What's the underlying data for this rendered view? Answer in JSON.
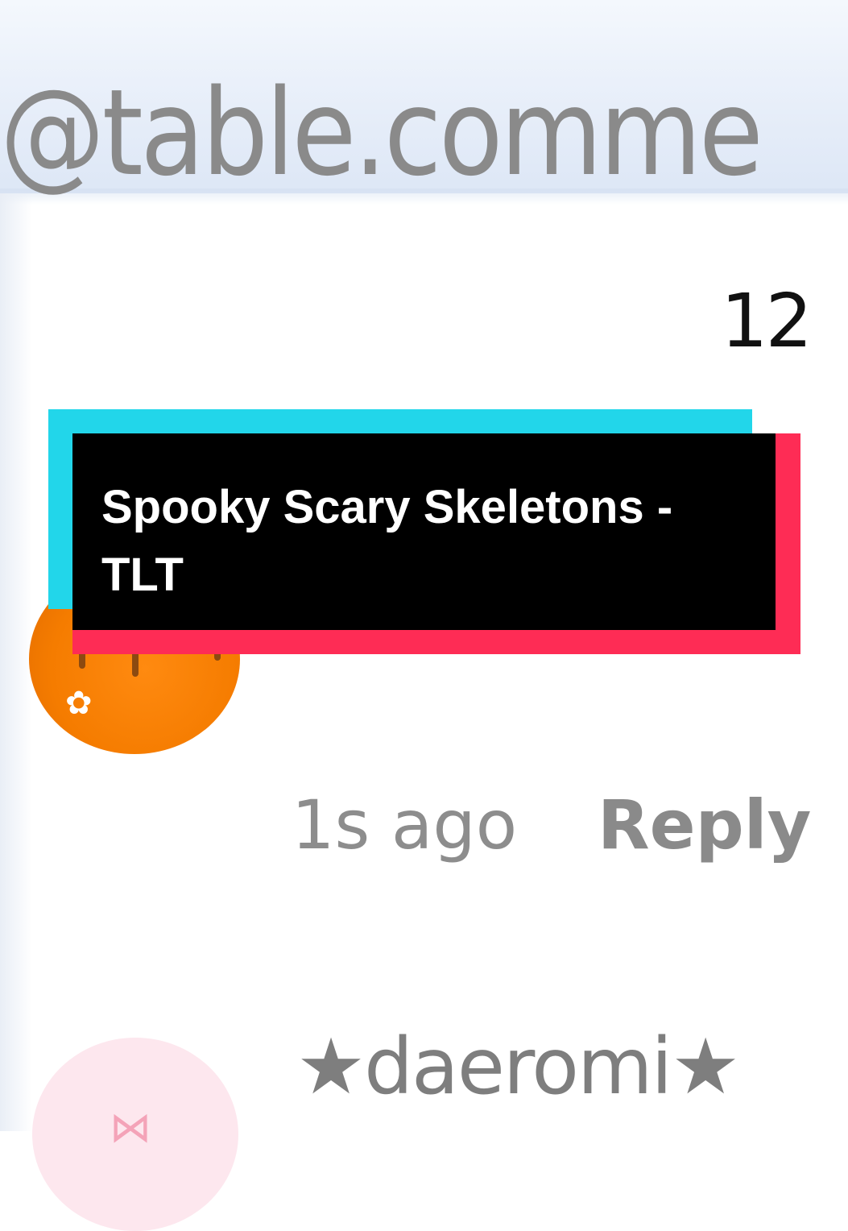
{
  "mention": "@table.comme",
  "comment_count": "12",
  "comment": {
    "time": "1s ago",
    "reply_label": "Reply"
  },
  "next_comment": {
    "username": "★daeromi★"
  },
  "overlay": {
    "title": "Spooky Scary Skeletons - TLT",
    "colors": {
      "cyan": "#22d6ea",
      "red": "#fe2c55",
      "black": "#000000"
    }
  },
  "icons": {
    "commenter_avatar": "orange-avatar",
    "next_avatar": "pink-bow-avatar"
  }
}
